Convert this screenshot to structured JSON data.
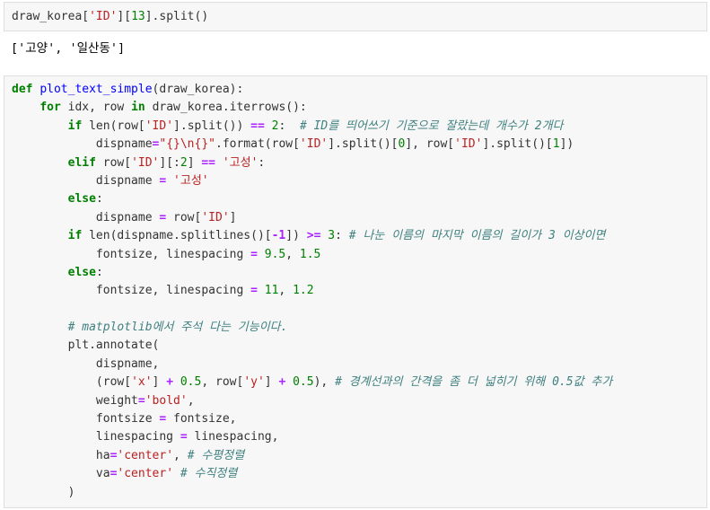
{
  "cell1": {
    "code_line": [
      {
        "t": "draw_korea[",
        "c": "nm"
      },
      {
        "t": "'ID'",
        "c": "str"
      },
      {
        "t": "][",
        "c": "nm"
      },
      {
        "t": "13",
        "c": "num"
      },
      {
        "t": "].split()",
        "c": "nm"
      }
    ]
  },
  "output": {
    "text": "['고양', '일산동']"
  },
  "cell2": {
    "lines": [
      [
        {
          "t": "def ",
          "c": "kw"
        },
        {
          "t": "plot_text_simple",
          "c": "fn"
        },
        {
          "t": "(draw_korea):",
          "c": "nm"
        }
      ],
      [
        {
          "t": "    ",
          "c": "nm"
        },
        {
          "t": "for ",
          "c": "kw"
        },
        {
          "t": "idx, row ",
          "c": "nm"
        },
        {
          "t": "in ",
          "c": "kw"
        },
        {
          "t": "draw_korea.iterrows():",
          "c": "nm"
        }
      ],
      [
        {
          "t": "        ",
          "c": "nm"
        },
        {
          "t": "if ",
          "c": "kw"
        },
        {
          "t": "len(row[",
          "c": "nm"
        },
        {
          "t": "'ID'",
          "c": "str"
        },
        {
          "t": "].split()) ",
          "c": "nm"
        },
        {
          "t": "==",
          "c": "op"
        },
        {
          "t": " ",
          "c": "nm"
        },
        {
          "t": "2",
          "c": "num"
        },
        {
          "t": ":  ",
          "c": "nm"
        },
        {
          "t": "# ID를 띄어쓰기 기준으로 잘랐는데 개수가 2개다",
          "c": "cm"
        }
      ],
      [
        {
          "t": "            dispname",
          "c": "nm"
        },
        {
          "t": "=",
          "c": "op"
        },
        {
          "t": "\"{}\\n{}\"",
          "c": "str"
        },
        {
          "t": ".format(row[",
          "c": "nm"
        },
        {
          "t": "'ID'",
          "c": "str"
        },
        {
          "t": "].split()[",
          "c": "nm"
        },
        {
          "t": "0",
          "c": "num"
        },
        {
          "t": "], row[",
          "c": "nm"
        },
        {
          "t": "'ID'",
          "c": "str"
        },
        {
          "t": "].split()[",
          "c": "nm"
        },
        {
          "t": "1",
          "c": "num"
        },
        {
          "t": "])",
          "c": "nm"
        }
      ],
      [
        {
          "t": "        ",
          "c": "nm"
        },
        {
          "t": "elif ",
          "c": "kw"
        },
        {
          "t": "row[",
          "c": "nm"
        },
        {
          "t": "'ID'",
          "c": "str"
        },
        {
          "t": "][:",
          "c": "nm"
        },
        {
          "t": "2",
          "c": "num"
        },
        {
          "t": "] ",
          "c": "nm"
        },
        {
          "t": "==",
          "c": "op"
        },
        {
          "t": " ",
          "c": "nm"
        },
        {
          "t": "'고성'",
          "c": "str"
        },
        {
          "t": ":",
          "c": "nm"
        }
      ],
      [
        {
          "t": "            dispname ",
          "c": "nm"
        },
        {
          "t": "=",
          "c": "op"
        },
        {
          "t": " ",
          "c": "nm"
        },
        {
          "t": "'고성'",
          "c": "str"
        }
      ],
      [
        {
          "t": "        ",
          "c": "nm"
        },
        {
          "t": "else",
          "c": "kw"
        },
        {
          "t": ":",
          "c": "nm"
        }
      ],
      [
        {
          "t": "            dispname ",
          "c": "nm"
        },
        {
          "t": "=",
          "c": "op"
        },
        {
          "t": " row[",
          "c": "nm"
        },
        {
          "t": "'ID'",
          "c": "str"
        },
        {
          "t": "]",
          "c": "nm"
        }
      ],
      [
        {
          "t": "        ",
          "c": "nm"
        },
        {
          "t": "if ",
          "c": "kw"
        },
        {
          "t": "len(dispname.splitlines()[",
          "c": "nm"
        },
        {
          "t": "-1",
          "c": "op"
        },
        {
          "t": "]) ",
          "c": "nm"
        },
        {
          "t": ">=",
          "c": "op"
        },
        {
          "t": " ",
          "c": "nm"
        },
        {
          "t": "3",
          "c": "num"
        },
        {
          "t": ": ",
          "c": "nm"
        },
        {
          "t": "# 나눈 이름의 마지막 이름의 길이가 3 이상이면",
          "c": "cm"
        }
      ],
      [
        {
          "t": "            fontsize, linespacing ",
          "c": "nm"
        },
        {
          "t": "=",
          "c": "op"
        },
        {
          "t": " ",
          "c": "nm"
        },
        {
          "t": "9.5",
          "c": "num"
        },
        {
          "t": ", ",
          "c": "nm"
        },
        {
          "t": "1.5",
          "c": "num"
        }
      ],
      [
        {
          "t": "        ",
          "c": "nm"
        },
        {
          "t": "else",
          "c": "kw"
        },
        {
          "t": ":",
          "c": "nm"
        }
      ],
      [
        {
          "t": "            fontsize, linespacing ",
          "c": "nm"
        },
        {
          "t": "=",
          "c": "op"
        },
        {
          "t": " ",
          "c": "nm"
        },
        {
          "t": "11",
          "c": "num"
        },
        {
          "t": ", ",
          "c": "nm"
        },
        {
          "t": "1.2",
          "c": "num"
        }
      ],
      [
        {
          "t": "",
          "c": "nm"
        }
      ],
      [
        {
          "t": "        ",
          "c": "nm"
        },
        {
          "t": "# matplotlib에서 주석 다는 기능이다.",
          "c": "cm"
        }
      ],
      [
        {
          "t": "        plt.annotate(",
          "c": "nm"
        }
      ],
      [
        {
          "t": "            dispname,",
          "c": "nm"
        }
      ],
      [
        {
          "t": "            (row[",
          "c": "nm"
        },
        {
          "t": "'x'",
          "c": "str"
        },
        {
          "t": "] ",
          "c": "nm"
        },
        {
          "t": "+",
          "c": "op"
        },
        {
          "t": " ",
          "c": "nm"
        },
        {
          "t": "0.5",
          "c": "num"
        },
        {
          "t": ", row[",
          "c": "nm"
        },
        {
          "t": "'y'",
          "c": "str"
        },
        {
          "t": "] ",
          "c": "nm"
        },
        {
          "t": "+",
          "c": "op"
        },
        {
          "t": " ",
          "c": "nm"
        },
        {
          "t": "0.5",
          "c": "num"
        },
        {
          "t": "), ",
          "c": "nm"
        },
        {
          "t": "# 경계선과의 간격을 좀 더 넓히기 위해 0.5값 추가",
          "c": "cm"
        }
      ],
      [
        {
          "t": "            weight",
          "c": "nm"
        },
        {
          "t": "=",
          "c": "op"
        },
        {
          "t": "'bold'",
          "c": "str"
        },
        {
          "t": ",",
          "c": "nm"
        }
      ],
      [
        {
          "t": "            fontsize ",
          "c": "nm"
        },
        {
          "t": "=",
          "c": "op"
        },
        {
          "t": " fontsize,",
          "c": "nm"
        }
      ],
      [
        {
          "t": "            linespacing ",
          "c": "nm"
        },
        {
          "t": "=",
          "c": "op"
        },
        {
          "t": " linespacing,",
          "c": "nm"
        }
      ],
      [
        {
          "t": "            ha",
          "c": "nm"
        },
        {
          "t": "=",
          "c": "op"
        },
        {
          "t": "'center'",
          "c": "str"
        },
        {
          "t": ", ",
          "c": "nm"
        },
        {
          "t": "# 수평정렬",
          "c": "cm"
        }
      ],
      [
        {
          "t": "            va",
          "c": "nm"
        },
        {
          "t": "=",
          "c": "op"
        },
        {
          "t": "'center'",
          "c": "str"
        },
        {
          "t": " ",
          "c": "nm"
        },
        {
          "t": "# 수직정렬",
          "c": "cm"
        }
      ],
      [
        {
          "t": "        )",
          "c": "nm"
        }
      ]
    ]
  }
}
